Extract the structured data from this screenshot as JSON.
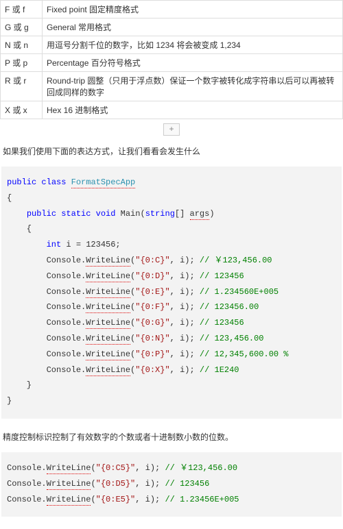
{
  "table": {
    "rows": [
      {
        "c1": "F 或 f",
        "c2": "Fixed point  固定精度格式"
      },
      {
        "c1": "G 或 g",
        "c2": "General  常用格式"
      },
      {
        "c1": "N 或 n",
        "c2": "用逗号分割千位的数字，比如 1234 将会被变成 1,234"
      },
      {
        "c1": "P 或 p",
        "c2": "Percentage  百分符号格式"
      },
      {
        "c1": "R 或 r",
        "c2": "Round-trip   圆整（只用于浮点数）保证一个数字被转化成字符串以后可以再被转回成同样的数字"
      },
      {
        "c1": "X 或 x",
        "c2": "Hex 16 进制格式"
      }
    ]
  },
  "plus": "+",
  "para1": "如果我们使用下面的表达方式，让我们看看会发生什么",
  "code1": {
    "kw_public": "public",
    "kw_class": "class",
    "typ_name": "FormatSpecApp",
    "kw_static": "static",
    "kw_void": "void",
    "fn_main": "Main",
    "kw_string": "string",
    "arg": "args",
    "kw_int": "int",
    "decl": " i = 123456;",
    "obj": "Console",
    "dot": ".",
    "method": "WriteLine",
    "lines": [
      {
        "fmt": "\"{0:C}\"",
        "tail": ", i); ",
        "cm": "// ￥123,456.00"
      },
      {
        "fmt": "\"{0:D}\"",
        "tail": ", i); ",
        "cm": "// 123456"
      },
      {
        "fmt": "\"{0:E}\"",
        "tail": ", i); ",
        "cm": "// 1.234560E+005"
      },
      {
        "fmt": "\"{0:F}\"",
        "tail": ", i); ",
        "cm": "// 123456.00"
      },
      {
        "fmt": "\"{0:G}\"",
        "tail": ", i); ",
        "cm": "// 123456"
      },
      {
        "fmt": "\"{0:N}\"",
        "tail": ", i); ",
        "cm": "// 123,456.00"
      },
      {
        "fmt": "\"{0:P}\"",
        "tail": ", i); ",
        "cm": "// 12,345,600.00 %"
      },
      {
        "fmt": "\"{0:X}\"",
        "tail": ", i); ",
        "cm": "// 1E240"
      }
    ]
  },
  "para2": "精度控制标识控制了有效数字的个数或者十进制数小数的位数。",
  "code2": {
    "obj": "Console",
    "dot": ".",
    "method": "WriteLine",
    "lines": [
      {
        "fmt": "\"{0:C5}\"",
        "tail": ", i); ",
        "cm": "// ￥123,456.00"
      },
      {
        "fmt": "\"{0:D5}\"",
        "tail": ", i); ",
        "cm": "// 123456"
      },
      {
        "fmt": "\"{0:E5}\"",
        "tail": ", i); ",
        "cm": "// 1.23456E+005"
      }
    ]
  }
}
